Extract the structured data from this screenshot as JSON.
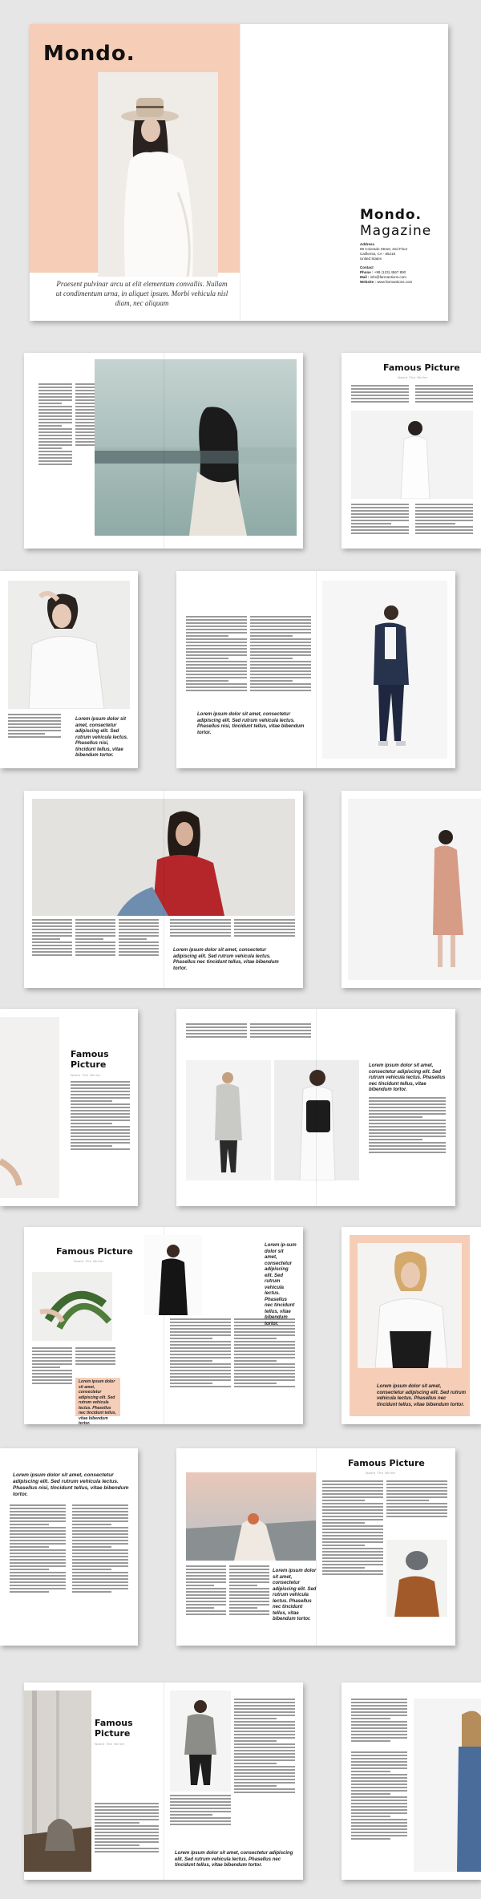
{
  "cover": {
    "title": "Mondo.",
    "intro": "Praesent pulvinar arcu ut elit elementum convallis. Nullam ut condimentum urna, in aliquet ipsum. Morbi vehicula nisl diam, nec aliquam",
    "magazine_title_1": "Mondo.",
    "magazine_title_2": "Magazine",
    "address_label": "Address",
    "address_1": "89 Colorado Street, 2nd Floor",
    "address_2": "California, CA - 85218",
    "address_3": "United States",
    "contact_label": "Contact",
    "phone_label": "Phone :",
    "phone": "+99 (123) 4567 890",
    "mail_label": "Mail :",
    "mail": "info@farmantions.com",
    "website_label": "Website :",
    "website": "www.farmantions.com"
  },
  "headings": {
    "famous_picture": "Famous Picture",
    "famous": "Famous",
    "picture": "Picture",
    "subtitle": "Name The Writer"
  },
  "quotes": {
    "lorem_long": "Lorem ipsum dolor sit amet, consectetur adipiscing elit. Sed rutrum vehicula lectus. Phasellus nisi, tincidunt tellus, vitae bibendum tortor.",
    "lorem_col": "Lorem ipsum dolor sit amet, consectetur adipiscing elit. Sed rutrum vehicula lectus. Phasellus nec tincidunt tellus, vitae bibendum tortor.",
    "lorem_narrow": "Lorem ipsum dolor sit amet, consectetur adipiscing elit. Sed rutrum vehicula lectus. Phasellus nisi, tincidunt tellus, vitae bibendum tortor.",
    "lorem_vertical": "Lorem ip-sum dolor sit amet, consectetur adipiscing elit. Sed rutrum vehicula lectus. Phasellus nec tincidunt tellus, vitae bibendum tortor.",
    "lorem_peach": "Lorem ipsum dolor sit amet, consectetur adipiscing elit. Sed rutrum vehicula lectus. Phasellus nec tincidunt tellus, vitae bibendum tortor.",
    "lorem_bottom": "Lorem ipsum dolor sit amet, consectetur adipiscing elit. Sed rutrum vehicula lectus. Phasellus nec tincidunt tellus, vitae bibendum tortor."
  },
  "colors": {
    "accent_peach": "#f6cdb6",
    "background": "#e6e6e6",
    "text": "#111111"
  }
}
